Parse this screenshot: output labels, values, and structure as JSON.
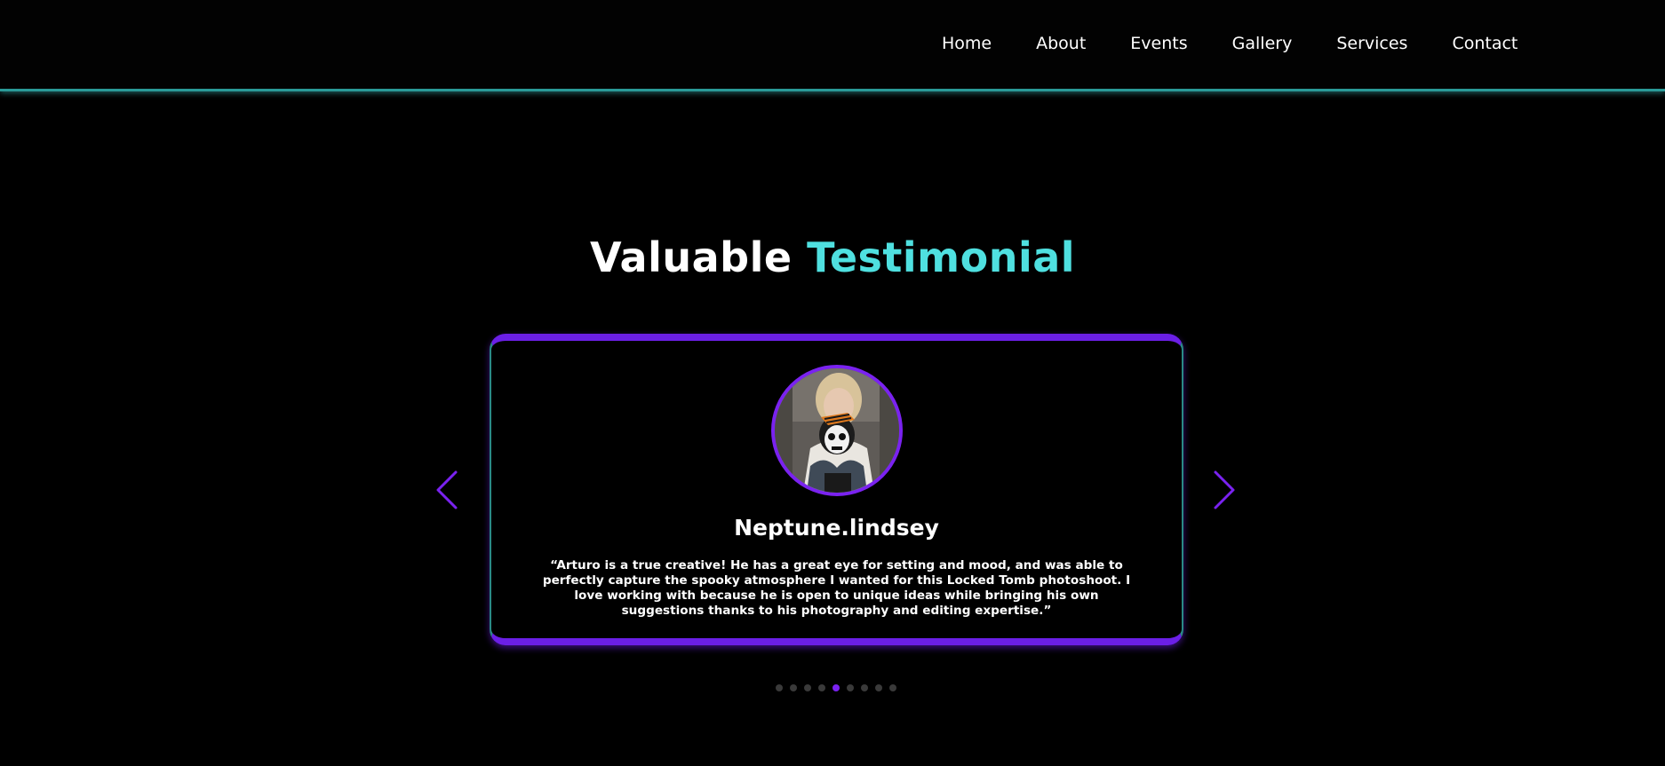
{
  "nav": {
    "items": [
      {
        "label": "Home"
      },
      {
        "label": "About"
      },
      {
        "label": "Events"
      },
      {
        "label": "Gallery"
      },
      {
        "label": "Services"
      },
      {
        "label": "Contact"
      }
    ]
  },
  "section": {
    "title_part1": "Valuable",
    "title_part2": "Testimonial"
  },
  "testimonial": {
    "name": "Neptune.lindsey",
    "quote": "“Arturo is a true creative! He has a great eye for setting and mood, and was able to perfectly capture the spooky atmosphere I wanted for this Locked Tomb photoshoot. I love working with because he is open to unique ideas while bringing his own suggestions thanks to his photography and editing expertise.”"
  },
  "carousel": {
    "prev_icon": "chevron-left-icon",
    "next_icon": "chevron-right-icon",
    "total_slides": 9,
    "active_slide": 5
  },
  "colors": {
    "background": "#000000",
    "accent_cyan": "#4fe0e0",
    "accent_purple": "#7a22f0",
    "header_border": "#2a9a98",
    "dot_inactive": "#3a3a3a"
  }
}
